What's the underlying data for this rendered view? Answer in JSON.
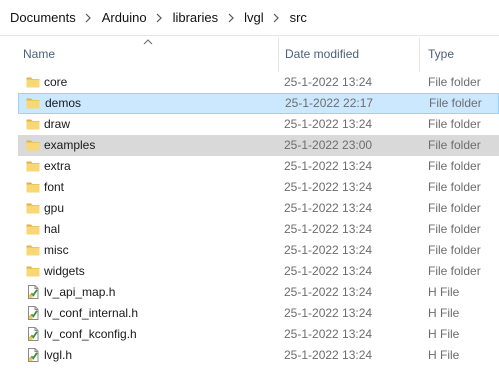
{
  "breadcrumb": [
    "Documents",
    "Arduino",
    "libraries",
    "lvgl",
    "src"
  ],
  "columns": {
    "name": "Name",
    "date_modified": "Date modified",
    "type": "Type"
  },
  "sort": {
    "column": "name",
    "direction": "ascending"
  },
  "items": [
    {
      "name": "core",
      "date": "25-1-2022 13:24",
      "type": "File folder",
      "icon": "folder-icon",
      "state": ""
    },
    {
      "name": "demos",
      "date": "25-1-2022 22:17",
      "type": "File folder",
      "icon": "folder-icon",
      "state": "selected"
    },
    {
      "name": "draw",
      "date": "25-1-2022 13:24",
      "type": "File folder",
      "icon": "folder-icon",
      "state": ""
    },
    {
      "name": "examples",
      "date": "25-1-2022 23:00",
      "type": "File folder",
      "icon": "folder-icon",
      "state": "hover"
    },
    {
      "name": "extra",
      "date": "25-1-2022 13:24",
      "type": "File folder",
      "icon": "folder-icon",
      "state": ""
    },
    {
      "name": "font",
      "date": "25-1-2022 13:24",
      "type": "File folder",
      "icon": "folder-icon",
      "state": ""
    },
    {
      "name": "gpu",
      "date": "25-1-2022 13:24",
      "type": "File folder",
      "icon": "folder-icon",
      "state": ""
    },
    {
      "name": "hal",
      "date": "25-1-2022 13:24",
      "type": "File folder",
      "icon": "folder-icon",
      "state": ""
    },
    {
      "name": "misc",
      "date": "25-1-2022 13:24",
      "type": "File folder",
      "icon": "folder-icon",
      "state": ""
    },
    {
      "name": "widgets",
      "date": "25-1-2022 13:24",
      "type": "File folder",
      "icon": "folder-icon",
      "state": ""
    },
    {
      "name": "lv_api_map.h",
      "date": "25-1-2022 13:24",
      "type": "H File",
      "icon": "header-file-icon",
      "state": ""
    },
    {
      "name": "lv_conf_internal.h",
      "date": "25-1-2022 13:24",
      "type": "H File",
      "icon": "header-file-icon",
      "state": ""
    },
    {
      "name": "lv_conf_kconfig.h",
      "date": "25-1-2022 13:24",
      "type": "H File",
      "icon": "header-file-icon",
      "state": ""
    },
    {
      "name": "lvgl.h",
      "date": "25-1-2022 13:24",
      "type": "H File",
      "icon": "header-file-icon",
      "state": ""
    }
  ],
  "colors": {
    "selected_bg": "#cce8ff",
    "selected_border": "#99d1ff",
    "hover_bg": "#d9d9d9",
    "folder": "#f8d775",
    "header_text": "#4c607a"
  }
}
